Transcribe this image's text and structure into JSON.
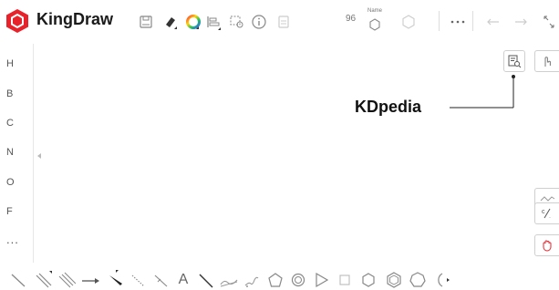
{
  "app": {
    "name": "KingDraw",
    "brand_color": "#e8222b"
  },
  "toolbar": {
    "zoom_value": "96",
    "name_label": "Name",
    "icons": [
      "save-icon",
      "eraser-icon",
      "color-wheel-icon",
      "align-icon",
      "select-icon",
      "info-icon",
      "page-icon",
      "name-structure-icon",
      "copy-icon",
      "more-icon",
      "undo-icon",
      "redo-icon",
      "fullscreen-icon"
    ]
  },
  "sidebar": {
    "elements": [
      "H",
      "B",
      "C",
      "N",
      "O",
      "F",
      "..."
    ]
  },
  "right_panel": {
    "kdpedia_label": "KDpedia"
  },
  "bottom_tools": {
    "text_tool": "A",
    "icons": [
      "single-bond-icon",
      "double-bond-icon",
      "triple-bond-icon",
      "arrow-icon",
      "wedge-bond-icon",
      "hash-bond-icon",
      "bold-hash-icon",
      "text-icon",
      "line-icon",
      "wave-icon",
      "chain-icon",
      "pentagon-icon",
      "ring-icon",
      "triangle-icon",
      "square-icon",
      "hexagon-icon",
      "benzene-icon",
      "heptagon-icon",
      "more-rings-icon"
    ]
  }
}
